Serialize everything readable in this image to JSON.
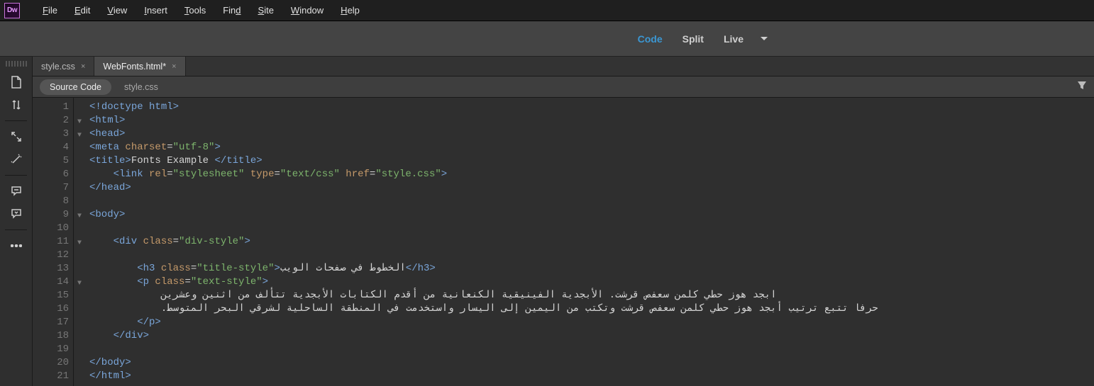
{
  "app": {
    "logo": "Dw"
  },
  "menubar": {
    "items": [
      {
        "label": "File",
        "ul": "F"
      },
      {
        "label": "Edit",
        "ul": "E"
      },
      {
        "label": "View",
        "ul": "V"
      },
      {
        "label": "Insert",
        "ul": "I"
      },
      {
        "label": "Tools",
        "ul": "T"
      },
      {
        "label": "Find",
        "ul": "F"
      },
      {
        "label": "Site",
        "ul": "S"
      },
      {
        "label": "Window",
        "ul": "W"
      },
      {
        "label": "Help",
        "ul": "H"
      }
    ]
  },
  "view_tabs": {
    "code": "Code",
    "split": "Split",
    "live": "Live"
  },
  "file_tabs": {
    "t0": {
      "label": "style.css"
    },
    "t1": {
      "label": "WebFonts.html*"
    }
  },
  "source_bar": {
    "source_code": "Source Code",
    "sub": "style.css"
  },
  "code_lines": {
    "l1": {
      "num": "1"
    },
    "l2": {
      "num": "2"
    },
    "l3": {
      "num": "3"
    },
    "l4": {
      "num": "4"
    },
    "l5": {
      "num": "5"
    },
    "l6": {
      "num": "6"
    },
    "l7": {
      "num": "7"
    },
    "l8": {
      "num": "8"
    },
    "l9": {
      "num": "9"
    },
    "l10": {
      "num": "10"
    },
    "l11": {
      "num": "11"
    },
    "l12": {
      "num": "12"
    },
    "l13": {
      "num": "13"
    },
    "l14": {
      "num": "14"
    },
    "l15": {
      "num": "15"
    },
    "l16": {
      "num": "16"
    },
    "l17": {
      "num": "17"
    },
    "l18": {
      "num": "18"
    },
    "l19": {
      "num": "19"
    },
    "l20": {
      "num": "20"
    },
    "l21": {
      "num": "21"
    }
  },
  "tokens": {
    "doctype_open": "<!",
    "doctype_word": "doctype html",
    "doctype_close": ">",
    "html_open": "<html>",
    "html_close": "</html>",
    "head_open": "<head>",
    "head_close": "</head>",
    "meta_open": "<meta",
    "charset_attr": " charset",
    "eq": "=",
    "utf8": "\"utf-8\"",
    "tag_end": ">",
    "title_open": "<title>",
    "title_text": "Fonts Example ",
    "title_close": "</title>",
    "link_open": "    <link",
    "rel_attr": " rel",
    "rel_val": "\"stylesheet\"",
    "type_attr": " type",
    "type_val": "\"text/css\"",
    "href_attr": " href",
    "href_val": "\"style.css\"",
    "body_open": "<body>",
    "body_close": "</body>",
    "div_open": "    <div",
    "class_attr": " class",
    "div_class": "\"div-style\"",
    "div_close": "    </div>",
    "h3_open": "        <h3",
    "h3_class": "\"title-style\"",
    "h3_text": "الخطوط في صفحات الويب",
    "h3_close": "</h3>",
    "p_open": "        <p",
    "p_class": "\"text-style\"",
    "p_close": "        </p>",
    "arabic1": "            ابجد هوز حطي كلمن سعفص قرشت. الأبجدية الفينيقية الكنعانية من أقدم الكتابات الأبجدية تتألف من اثنين وعشرين",
    "arabic2": "            .حرفا تتبع ترتيب أبجد هوز حطي كلمن سعفص قرشت وتكتب من اليمين إلى اليسار واستخدمت في المنطقة الساحلية لشرقي البحر المتوسط"
  }
}
